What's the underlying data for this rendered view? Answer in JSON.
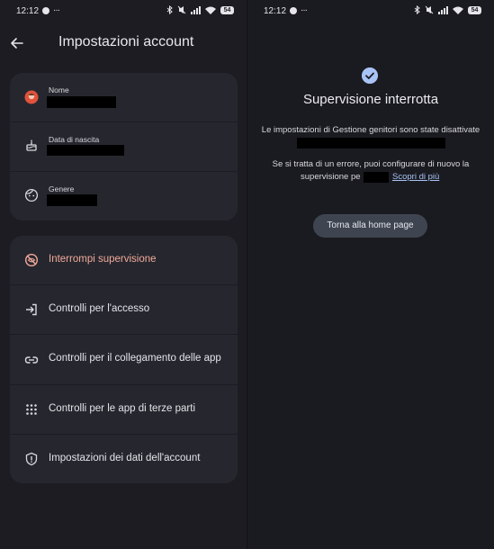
{
  "status_bar": {
    "time": "12:12",
    "more": "···",
    "battery": "54"
  },
  "left": {
    "title": "Impostazioni account",
    "profile_items": [
      {
        "label": "Nome",
        "icon": "avatar-icon"
      },
      {
        "label": "Data di nascita",
        "icon": "cake-icon"
      },
      {
        "label": "Genere",
        "icon": "face-icon"
      }
    ],
    "menu_items": [
      {
        "label": "Interrompi supervisione",
        "icon": "eye-off-icon",
        "color": "#f2a99a"
      },
      {
        "label": "Controlli per l'accesso",
        "icon": "login-icon"
      },
      {
        "label": "Controlli per il collegamento delle app",
        "icon": "link-icon"
      },
      {
        "label": "Controlli per le app di terze parti",
        "icon": "grid-icon"
      },
      {
        "label": "Impostazioni dei dati dell'account",
        "icon": "shield-icon"
      }
    ]
  },
  "right": {
    "title": "Supervisione interrotta",
    "text1": "Le impostazioni di Gestione genitori sono state disattivate",
    "text2": "Se si tratta di un errore, puoi configurare di nuovo la",
    "text3": "supervisione pe",
    "link": "Scopri di più",
    "button": "Torna alla home page"
  },
  "colors": {
    "accent": "#a8c3f5",
    "danger": "#f2a99a",
    "card": "#26272e",
    "background": "#1c1c22"
  }
}
